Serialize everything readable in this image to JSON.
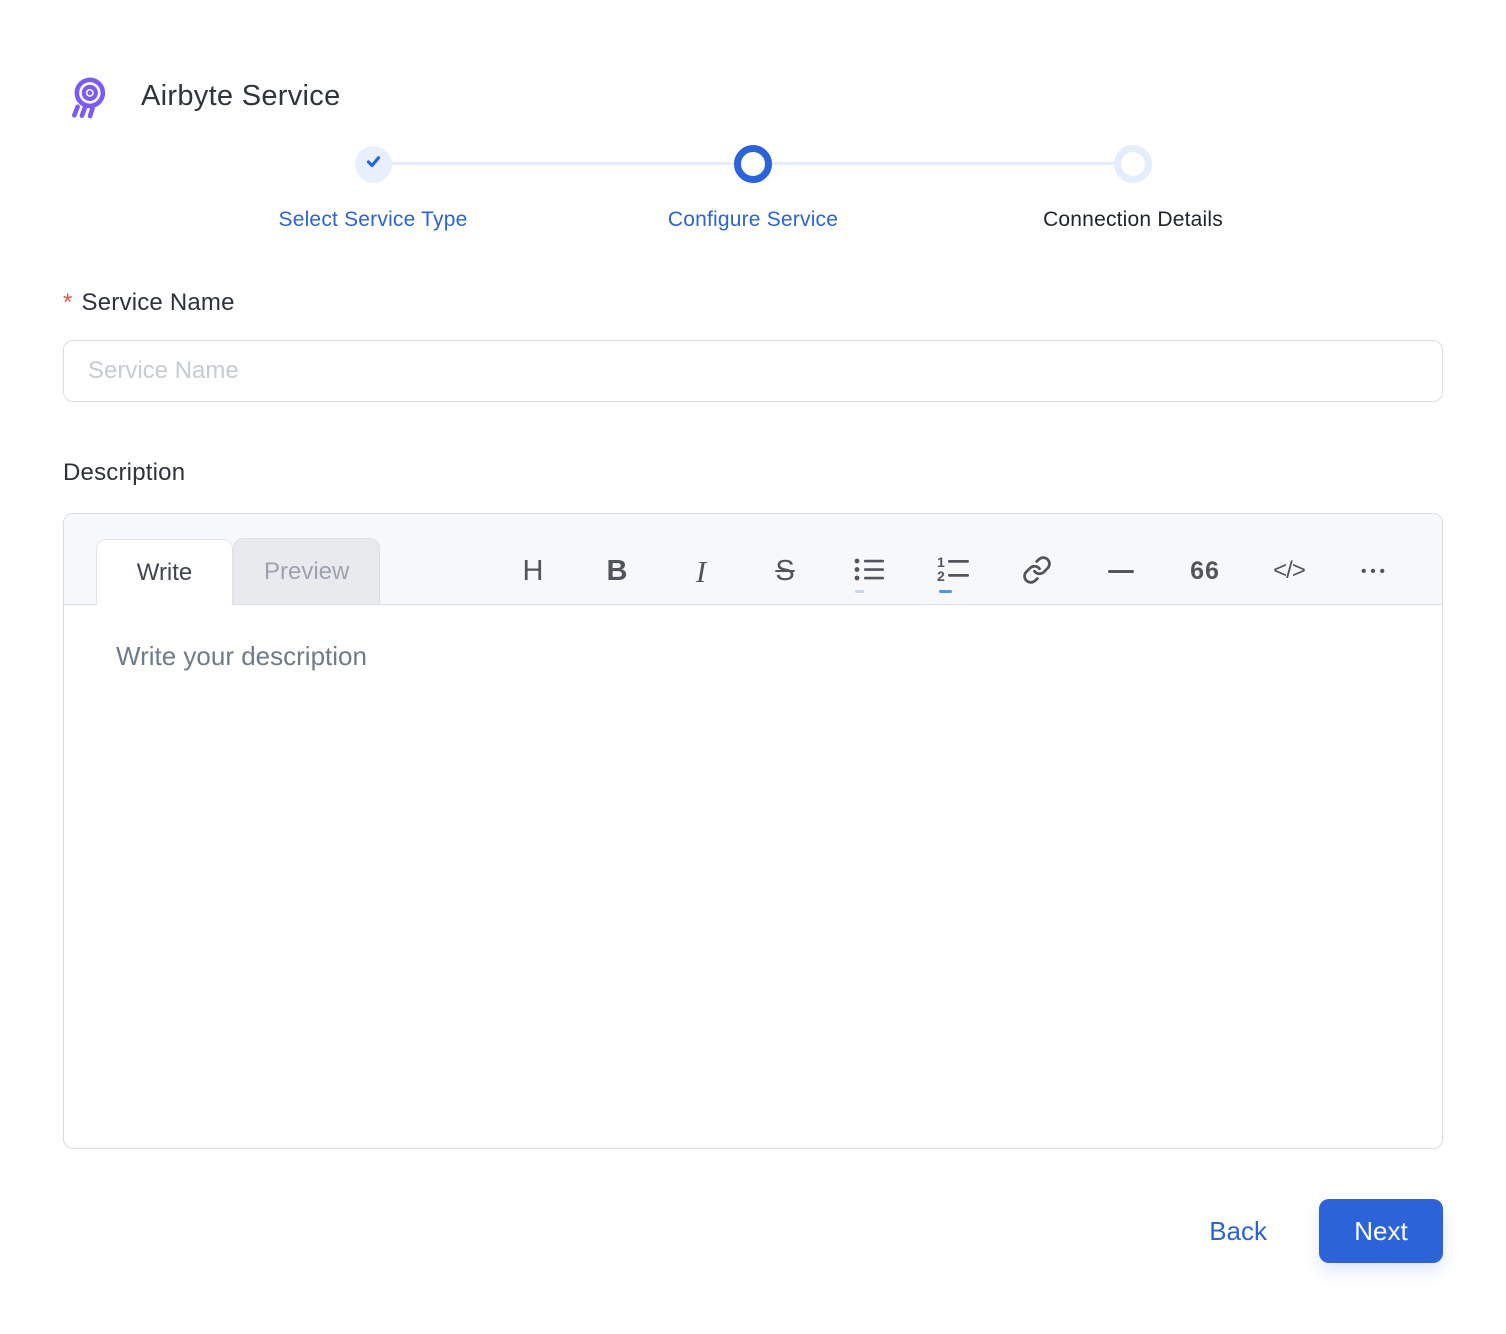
{
  "header": {
    "title": "Airbyte Service"
  },
  "stepper": {
    "steps": [
      {
        "label": "Select Service Type",
        "state": "completed"
      },
      {
        "label": "Configure Service",
        "state": "active"
      },
      {
        "label": "Connection Details",
        "state": "upcoming"
      }
    ]
  },
  "form": {
    "service_name": {
      "required_marker": "*",
      "label": "Service Name",
      "placeholder": "Service Name",
      "value": ""
    },
    "description": {
      "label": "Description",
      "tabs": {
        "write": "Write",
        "preview": "Preview"
      },
      "toolbar": {
        "heading": "H",
        "bold": "B",
        "italic": "I",
        "strikethrough": "S",
        "quote": "66",
        "code": "</>",
        "more": "•••",
        "icon_names": [
          "heading",
          "bold",
          "italic",
          "strikethrough",
          "bullet-list",
          "ordered-list",
          "link",
          "horizontal-rule",
          "quote",
          "code",
          "more"
        ]
      },
      "placeholder": "Write your description",
      "value": ""
    }
  },
  "footer": {
    "back_label": "Back",
    "next_label": "Next"
  },
  "colors": {
    "accent_blue": "#2d63d9",
    "pale_blue": "#e3edfb",
    "logo_purple": "#7b5bf7",
    "required_red": "#e2574c",
    "toolbar_bg": "#f7f8fa"
  }
}
